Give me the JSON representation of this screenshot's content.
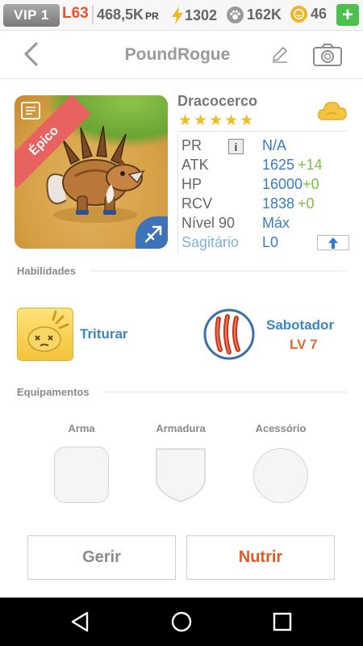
{
  "statusbar": {
    "vip": "VIP 1",
    "level": "L63",
    "power_value": "468,5K",
    "power_unit": "PR",
    "energy": "1302",
    "paws": "162K",
    "coins": "46",
    "add": "+"
  },
  "header": {
    "title": "PoundRogue"
  },
  "pet": {
    "name": "Dracocerco",
    "rarity": "Épico",
    "star_count": 5,
    "stats": {
      "pr_label": "PR",
      "pr_value": "N/A",
      "info": "i",
      "atk_label": "ATK",
      "atk_value": "1625",
      "atk_bonus": "+14",
      "hp_label": "HP",
      "hp_value": "16000",
      "hp_bonus": "+0",
      "rcv_label": "RCV",
      "rcv_value": "1838",
      "rcv_bonus": "+0",
      "level_label": "Nível 90",
      "level_value": "Máx",
      "element_label": "Sagitário",
      "element_value": "L0"
    }
  },
  "abilities": {
    "heading": "Habilidades",
    "skill1": "Triturar",
    "skill2": "Sabotador",
    "skill2_level": "LV 7"
  },
  "equipment": {
    "heading": "Equipamentos",
    "slots": [
      "Arma",
      "Armadura",
      "Acessório"
    ]
  },
  "buttons": {
    "manage": "Gerir",
    "feed": "Nutrir"
  },
  "colors": {
    "accent_blue": "#3a7bc0",
    "bonus_green": "#7cbf42",
    "epic_red": "#e8625f",
    "feed_orange": "#e05a24"
  }
}
